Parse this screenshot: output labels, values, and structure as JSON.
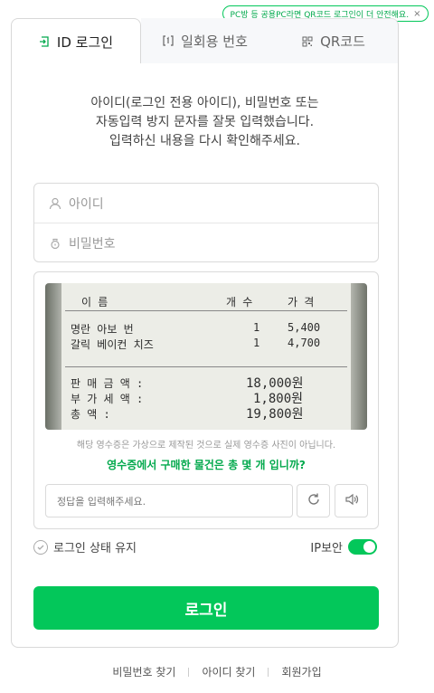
{
  "tooltip": {
    "text": "PC방 등 공용PC라면 QR코드 로그인이 더 안전해요.",
    "close": "×"
  },
  "tabs": [
    {
      "label": "ID 로그인",
      "icon": "id-login-icon"
    },
    {
      "label": "일회용 번호",
      "icon": "onetime-number-icon"
    },
    {
      "label": "QR코드",
      "icon": "qr-code-icon"
    }
  ],
  "error": {
    "line1": "아이디(로그인 전용 아이디), 비밀번호 또는",
    "line2": "자동입력 방지 문자를 잘못 입력했습니다.",
    "line3": "입력하신 내용을 다시 확인해주세요."
  },
  "id_field": {
    "placeholder": "아이디"
  },
  "pw_field": {
    "placeholder": "비밀번호"
  },
  "receipt": {
    "header_name": "이   름",
    "header_qty": "개 수",
    "header_price": "가 격",
    "items": [
      {
        "name": "명란 아보 번",
        "qty": "1",
        "price": "5,400"
      },
      {
        "name": "갈릭 베이컨 치즈",
        "qty": "1",
        "price": "4,700"
      }
    ],
    "sale_label": "판 매 금 액 :",
    "sale_value": "18,000원",
    "vat_label": "부 가 세 액 :",
    "vat_value": "1,800원",
    "total_label": "총      액 :",
    "total_value": "19,800원"
  },
  "captcha": {
    "notice": "해당 영수증은 가상으로 제작된 것으로 실제 영수증 사진이 아닙니다.",
    "question": "영수증에서 구매한 물건은 총 몇 개 입니까?",
    "answer_placeholder": "정답을 입력해주세요."
  },
  "keep_login": "로그인 상태 유지",
  "ip_security": "IP보안",
  "ip_security_on": true,
  "login_button": "로그인",
  "footer": {
    "find_pw": "비밀번호 찾기",
    "find_id": "아이디 찾기",
    "signup": "회원가입"
  },
  "colors": {
    "accent": "#03c75a",
    "accent_text": "#03a94d"
  }
}
